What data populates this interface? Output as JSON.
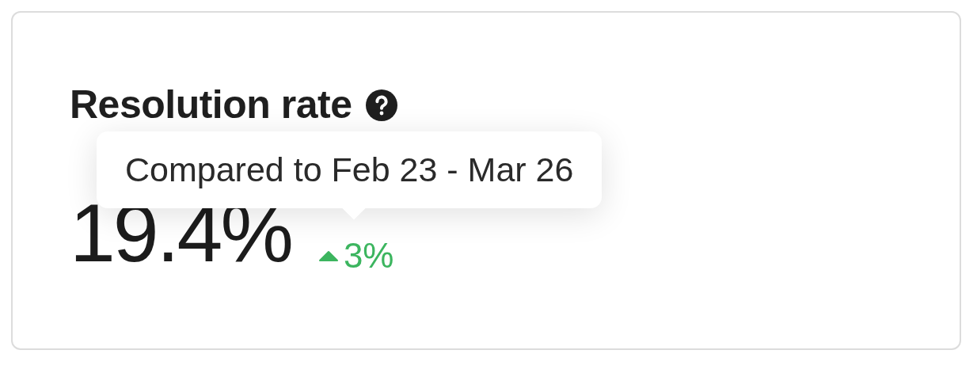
{
  "card": {
    "title": "Resolution rate",
    "value": "19.4%",
    "change": {
      "increase": true,
      "text": "3%"
    },
    "tooltip": {
      "text": "Compared to Feb 23 - Mar 26"
    }
  }
}
